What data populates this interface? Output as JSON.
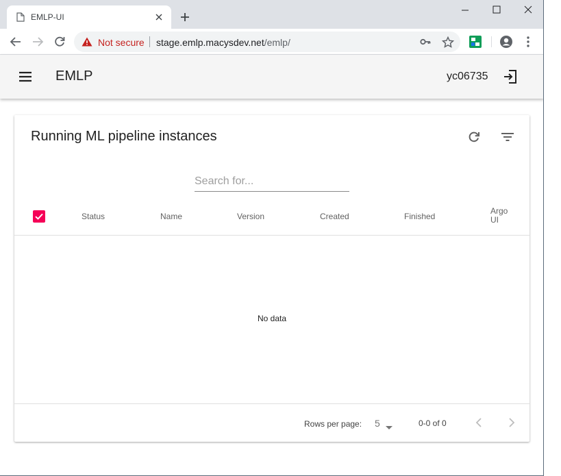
{
  "browser": {
    "tab_title": "EMLP-UI",
    "security_label": "Not secure",
    "url_host": "stage.emlp.macysdev.net",
    "url_path": "/emlp/"
  },
  "app": {
    "title": "EMLP",
    "username": "yc06735"
  },
  "card": {
    "title": "Running ML pipeline instances",
    "search_placeholder": "Search for...",
    "columns": [
      "Status",
      "Name",
      "Version",
      "Created",
      "Finished",
      "Argo UI"
    ],
    "empty_message": "No data",
    "rows_per_page_label": "Rows per page:",
    "rows_per_page_value": "5",
    "range_label": "0-0 of 0"
  },
  "colors": {
    "accent": "#f50057",
    "not_secure": "#c5221f"
  }
}
